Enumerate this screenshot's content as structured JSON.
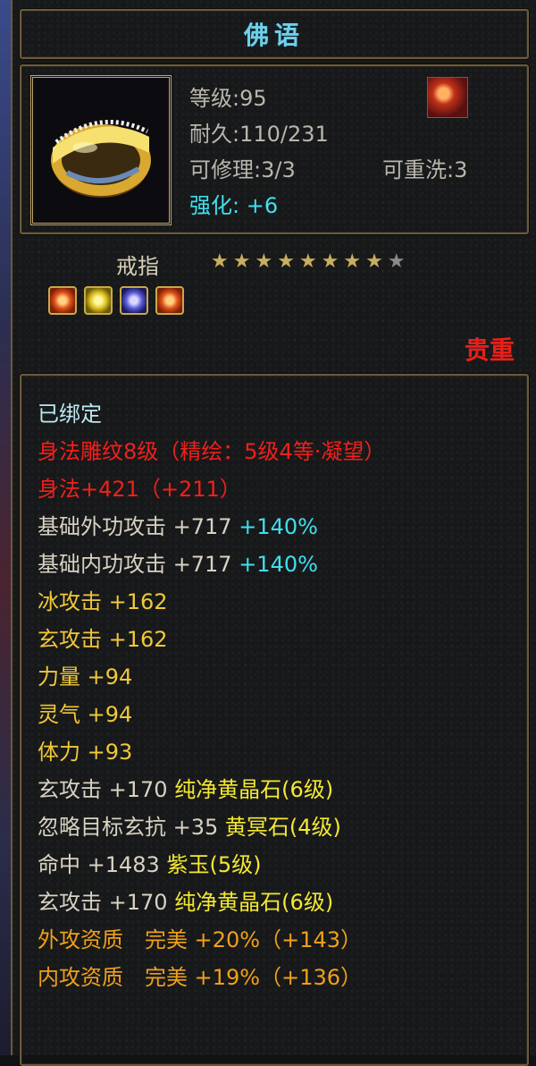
{
  "title": "佛语",
  "item": {
    "level": "等级:95",
    "durability": "耐久:110/231",
    "repairable": "可修理:3/3",
    "rewash": "可重洗:3",
    "enhance_label": "强化:",
    "enhance_value": "+6",
    "type": "戒指",
    "stars_filled": 8,
    "stars_total": 9,
    "rarity": "贵重"
  },
  "gems": [
    "red-gem-icon",
    "yellow-gem-icon",
    "purple-gem-icon",
    "red-gem-icon"
  ],
  "colors": {
    "title": "#6fd0ea",
    "cyan": "#3fe0ee",
    "red": "#f0201a",
    "gold": "#f0c838",
    "orange": "#f0a018",
    "white": "#d8d2c2"
  },
  "attributes": {
    "bound": "已绑定",
    "carving": "身法雕纹8级（精绘：5级4等·凝望）",
    "agility": "身法+421（+211）",
    "ext_attack": "基础外功攻击 +717",
    "ext_attack_pct": "+140%",
    "int_attack": "基础内功攻击 +717",
    "int_attack_pct": "+140%",
    "ice": "冰攻击 +162",
    "xuan": "玄攻击 +162",
    "strength": "力量 +94",
    "spirit": "灵气 +94",
    "stamina": "体力 +93",
    "gem1_stat": "玄攻击 +170",
    "gem1_name": "纯净黄晶石(6级)",
    "gem2_stat": "忽略目标玄抗 +35",
    "gem2_name": "黄冥石(4级)",
    "gem3_stat": "命中 +1483",
    "gem3_name": "紫玉(5级)",
    "gem4_stat": "玄攻击 +170",
    "gem4_name": "纯净黄晶石(6级)",
    "ext_quality": "外攻资质　完美 +20%（+143）",
    "int_quality": "内攻资质　完美 +19%（+136）"
  }
}
